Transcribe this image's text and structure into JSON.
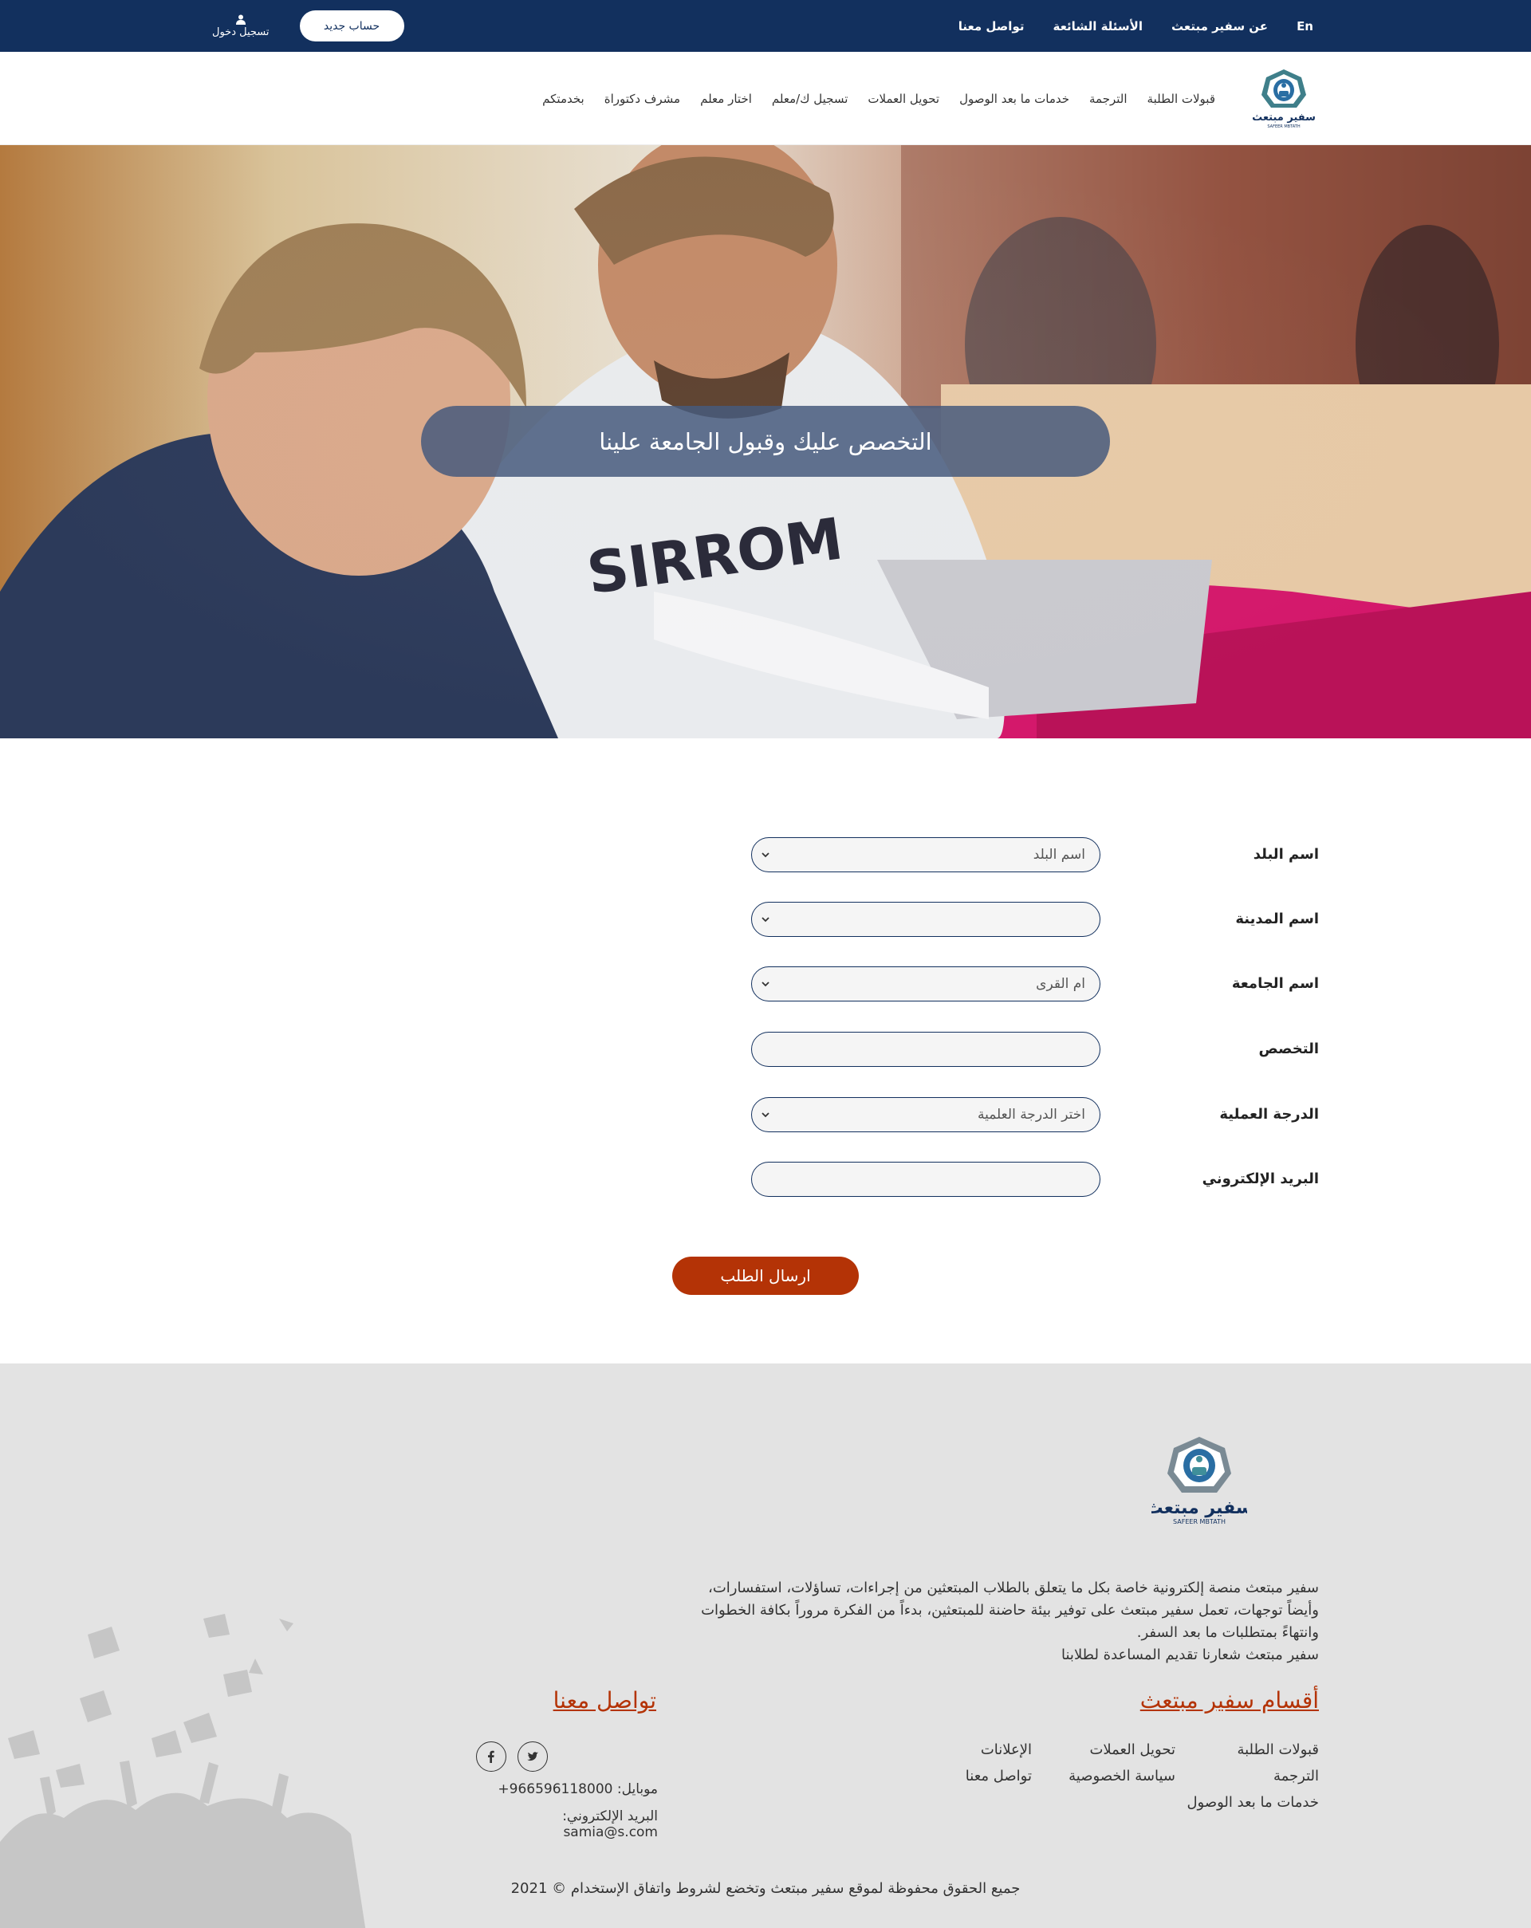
{
  "topbar": {
    "lang": "En",
    "about": "عن سفير مبتعث",
    "faq": "الأسئلة الشائعة",
    "contact": "تواصل معنا",
    "login": "تسجيل دخول",
    "new_account": "حساب جديد"
  },
  "brand": {
    "logo_text": "سفير مبتعث",
    "logo_sub": "SAFEER MBTATH"
  },
  "nav": {
    "items": [
      "قبولات الطلبة",
      "الترجمة",
      "خدمات ما بعد الوصول",
      "تحويل العملات",
      "تسجيل ك/معلم",
      "اختار معلم",
      "مشرف دكتوراة",
      "بخدمتكم"
    ]
  },
  "hero": {
    "title": "التخصص عليك وقبول الجامعة علينا"
  },
  "form": {
    "country": {
      "label": "اسم البلد",
      "value": "اسم البلد"
    },
    "city": {
      "label": "اسم المدينة",
      "value": ""
    },
    "university": {
      "label": "اسم الجامعة",
      "value": "ام القرى"
    },
    "major": {
      "label": "التخصص",
      "value": ""
    },
    "degree": {
      "label": "الدرجة العملية",
      "value": "اختر الدرجة العلمية"
    },
    "email": {
      "label": "البريد الإلكتروني",
      "value": ""
    },
    "submit": "ارسال الطلب"
  },
  "footer": {
    "about_lines": [
      "سفير مبتعث منصة إلكترونية خاصة بكل ما يتعلق بالطلاب المبتعثين من إجراءات، تساؤلات، استفسارات،",
      "وأيضاً توجهات، تعمل سفير مبتعث على توفير بيئة حاضنة للمبتعثين، بدءاً من الفكرة مروراً بكافة الخطوات",
      "وانتهاءً بمتطلبات ما بعد السفر.",
      "سفير مبتعث شعارنا تقديم المساعدة لطلابنا"
    ],
    "sections_title": "أقسام سفير مبتعث",
    "sections": [
      "قبولات الطلبة",
      "تحويل العملات",
      "الإعلانات",
      "الترجمة",
      "سياسة الخصوصية",
      "تواصل معنا",
      "خدمات ما بعد الوصول"
    ],
    "contact_title": "تواصل معنا",
    "mobile": "موبايل: 966596118000+",
    "email": "البريد الإلكتروني: samia@s.com",
    "copyright": "جميع الحقوق محفوظة لموقع سفير مبتعث وتخضع لشروط واتفاق الإستخدام © 2021"
  },
  "colors": {
    "primary": "#12305e",
    "accent": "#b43306",
    "footer_bg": "#e3e3e3"
  }
}
